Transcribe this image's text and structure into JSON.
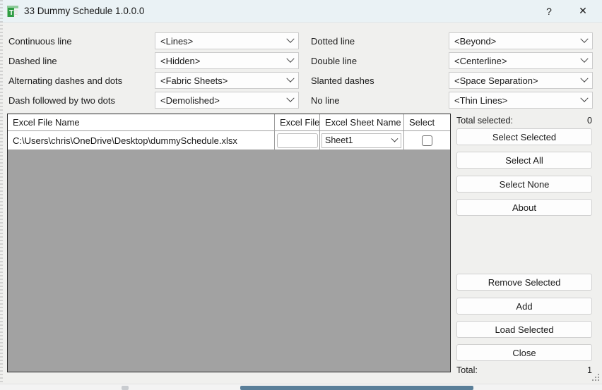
{
  "window": {
    "title": "33 Dummy Schedule 1.0.0.0",
    "app_icon": "excel-sheet-icon",
    "help_label": "?",
    "close_label": "✕",
    "titlebar_color": "#eaf2f5",
    "body_color": "#f0f0ee"
  },
  "form": {
    "left_fields": [
      {
        "label": "Continuous line",
        "value": "<Lines>"
      },
      {
        "label": "Dashed line",
        "value": "<Hidden>"
      },
      {
        "label": "Alternating dashes and dots",
        "value": "<Fabric Sheets>"
      },
      {
        "label": "Dash followed by two dots",
        "value": "<Demolished>"
      }
    ],
    "right_fields": [
      {
        "label": "Dotted line",
        "value": "<Beyond>"
      },
      {
        "label": "Double line",
        "value": "<Centerline>"
      },
      {
        "label": "Slanted dashes",
        "value": "<Space Separation>"
      },
      {
        "label": "No line",
        "value": "<Thin Lines>"
      }
    ]
  },
  "grid": {
    "background_color": "#a2a2a2",
    "columns": [
      "Excel File Name",
      "Excel File",
      "Excel Sheet Name",
      "Select"
    ],
    "rows": [
      {
        "file_name": "C:\\Users\\chris\\OneDrive\\Desktop\\dummySchedule.xlsx",
        "excel_file": "",
        "sheet_name": "Sheet1",
        "selected": false
      }
    ]
  },
  "panel": {
    "total_selected_label": "Total selected:",
    "total_selected_value": "0",
    "buttons_top": [
      "Select Selected",
      "Select All",
      "Select None",
      "About"
    ],
    "buttons_bottom": [
      "Remove Selected",
      "Add",
      "Load Selected",
      "Close"
    ],
    "total_label": "Total:",
    "total_value": "1"
  }
}
